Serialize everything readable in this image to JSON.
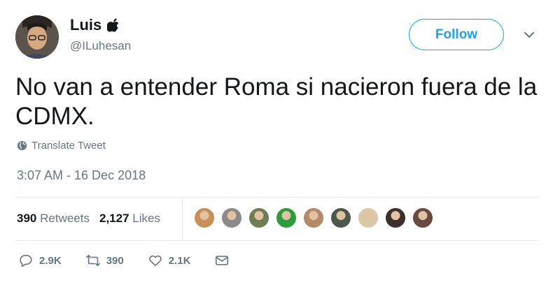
{
  "user": {
    "name": "Luis",
    "handle": "@ILuhesan",
    "badge_icon": "apple-icon"
  },
  "header": {
    "follow_label": "Follow",
    "menu_icon": "chevron-down-icon",
    "accent_color": "#1da1f2"
  },
  "tweet": {
    "text": "No van a entender Roma si nacieron fuera de la CDMX.",
    "translate_label": "Translate Tweet",
    "timestamp": "3:07 AM - 16 Dec 2018"
  },
  "stats": {
    "retweets_count": "390",
    "retweets_label": "Retweets",
    "likes_count": "2,127",
    "likes_label": "Likes"
  },
  "likers": [
    {
      "color": "#c98f5a"
    },
    {
      "color": "#8a8a8a"
    },
    {
      "color": "#6e7d52"
    },
    {
      "color": "#2e9b3c"
    },
    {
      "color": "#b38a6a"
    },
    {
      "color": "#4a5a4a"
    },
    {
      "color": "#d8c8a8"
    },
    {
      "color": "#3a3030"
    },
    {
      "color": "#6a4a40"
    }
  ],
  "actions": {
    "replies": "2.9K",
    "retweets": "390",
    "likes": "2.1K"
  }
}
